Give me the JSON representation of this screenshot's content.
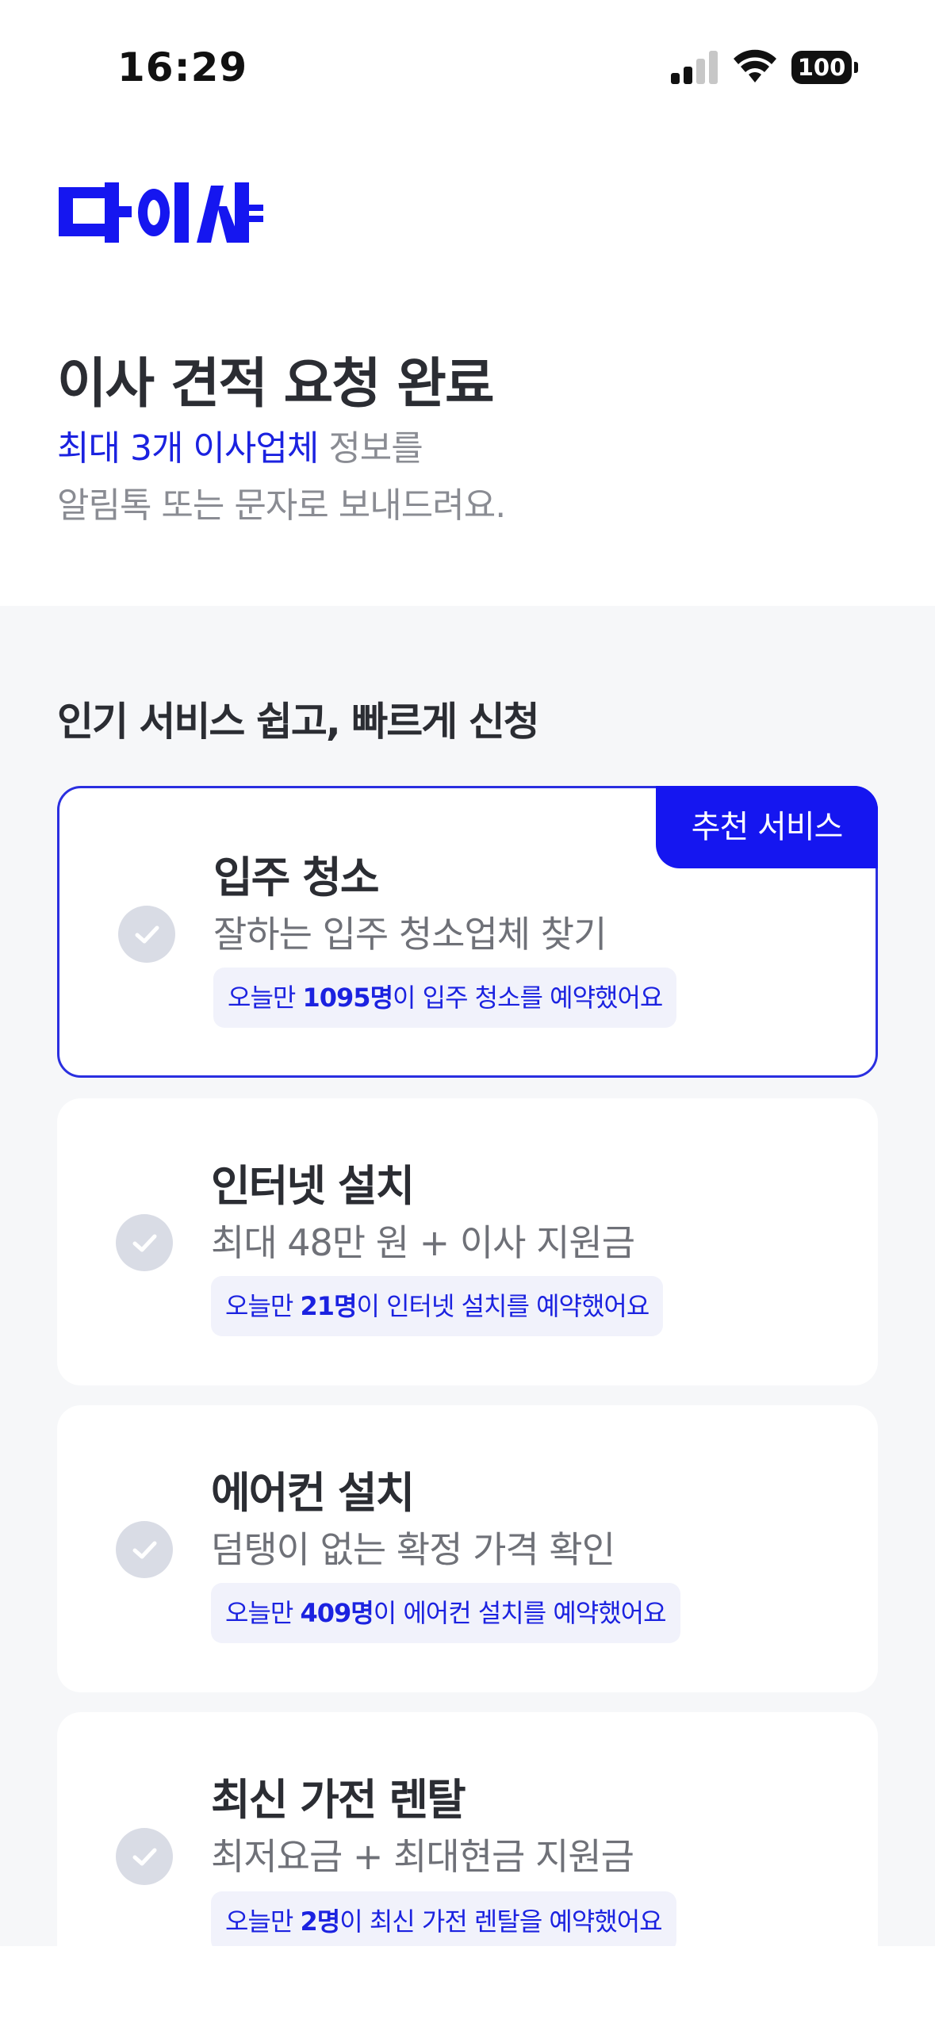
{
  "status_bar": {
    "time": "16:29",
    "battery": "100"
  },
  "logo": {
    "text": "다이사",
    "color": "#1516f0"
  },
  "header": {
    "title": "이사 견적 요청 완료",
    "desc_accent": "최대 3개 이사업체",
    "desc_rest": " 정보를",
    "desc_line2": "알림톡 또는 문자로 보내드려요."
  },
  "section": {
    "title": "인기 서비스 쉽고, 빠르게 신청"
  },
  "cards": [
    {
      "title": "입주 청소",
      "sub": "잘하는 입주 청소업체 찾기",
      "note_pre": "오늘만 ",
      "note_count": "1095명",
      "note_post": "이 입주 청소를 예약했어요",
      "badge": "추천 서비스"
    },
    {
      "title": "인터넷 설치",
      "sub": "최대 48만 원 + 이사 지원금",
      "note_pre": "오늘만 ",
      "note_count": "21명",
      "note_post": "이 인터넷 설치를 예약했어요"
    },
    {
      "title": "에어컨 설치",
      "sub": "덤탱이 없는 확정 가격 확인",
      "note_pre": "오늘만 ",
      "note_count": "409명",
      "note_post": "이 에어컨 설치를 예약했어요"
    },
    {
      "title": "최신 가전 렌탈",
      "sub": "최저요금 + 최대현금 지원금",
      "note_pre": "오늘만 ",
      "note_count": "2명",
      "note_post": "이 최신 가전 렌탈을 예약했어요"
    }
  ],
  "colors": {
    "accent": "#1b22e0",
    "badge": "#1516f0",
    "check": "#d9dce5"
  }
}
